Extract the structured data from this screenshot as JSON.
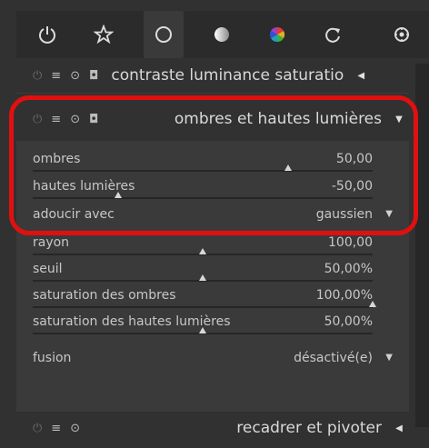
{
  "topbar": {
    "icons": [
      "power-icon",
      "star-icon",
      "circle-icon",
      "half-circle-icon",
      "color-wheel-icon",
      "refresh-icon",
      "settings-wheel-icon"
    ]
  },
  "modules": {
    "top": {
      "title": "contraste luminance saturatio"
    },
    "active": {
      "title": "ombres et hautes lumières"
    },
    "bottom": {
      "title": "recadrer et pivoter"
    }
  },
  "params": [
    {
      "label": "ombres",
      "value": "50,00",
      "level": 0.75
    },
    {
      "label": "hautes lumières",
      "value": "-50,00",
      "level": 0.25
    },
    {
      "label": "adoucir avec",
      "value": "gaussien"
    },
    {
      "label": "rayon",
      "value": "100,00",
      "level": 0.5
    },
    {
      "label": "seuil",
      "value": "50,00%",
      "level": 0.5
    },
    {
      "label": "saturation des ombres",
      "value": "100,00%",
      "level": 1.0
    },
    {
      "label": "saturation des hautes lumières",
      "value": "50,00%",
      "level": 0.5
    },
    {
      "label": "fusion",
      "value": "désactivé(e)"
    }
  ],
  "colors": {
    "highlight": "#e01010",
    "panel": "#3a3a3a",
    "background": "#313131"
  }
}
